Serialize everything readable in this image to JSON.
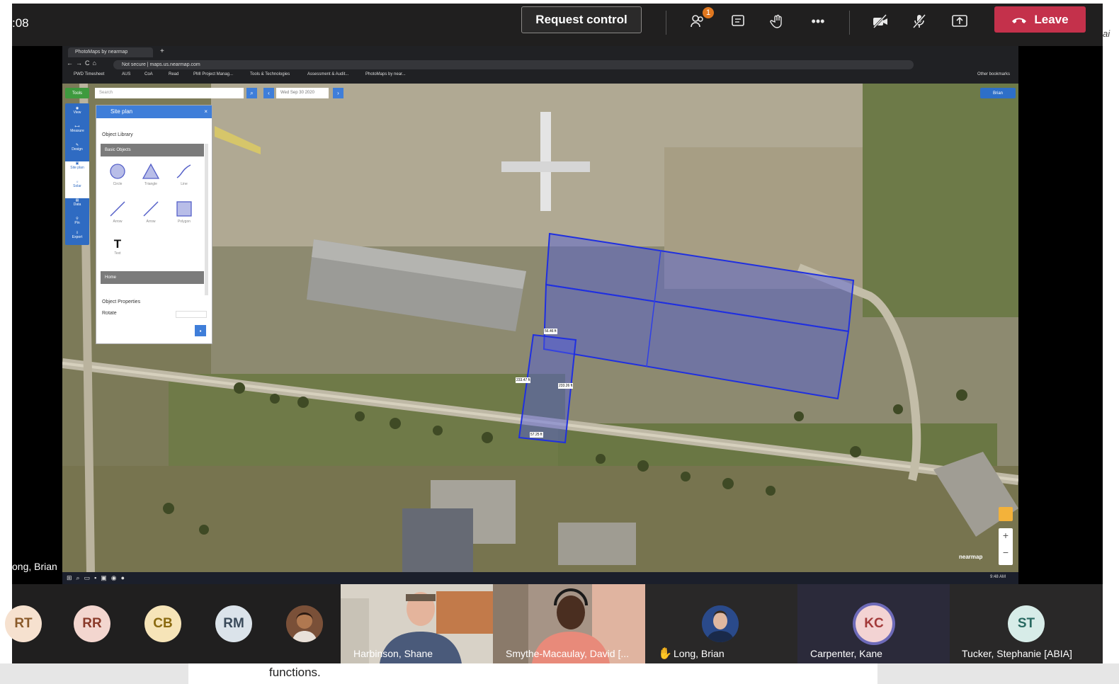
{
  "clock": ":08",
  "toolbar": {
    "request_control": "Request control",
    "badge_count": "1",
    "leave_label": "Leave",
    "icons": [
      "people-icon",
      "chat-icon",
      "raise-hand-icon",
      "more-icon",
      "camera-off-icon",
      "mic-off-icon",
      "share-tray-icon"
    ]
  },
  "right_edge_text": "ai",
  "browser": {
    "tab_title": "PhotoMaps by nearmap",
    "address": "Not secure | maps.us.nearmap.com",
    "bookmarks": [
      "PWD Timesheet",
      "AUS",
      "CoA",
      "Read",
      "PMI Project Manag...",
      "Tools & Technologies",
      "Assessment & Audit...",
      "PhotoMaps by near..."
    ],
    "other_bookmarks": "Other bookmarks"
  },
  "map_ui": {
    "tools_label": "Tools",
    "search_placeholder": "Search",
    "date_label": "Wed Sep 30 2020",
    "user_label": "Brian",
    "side_nav": [
      "View",
      "Measure",
      "Design",
      "Site plan",
      "Solar",
      "Data",
      "Pin",
      "Export"
    ],
    "brand": "nearmap",
    "measurements": [
      "56.46 ft",
      "233.47 ft",
      "233.26 ft",
      "57.25 ft"
    ],
    "panel": {
      "title": "Site plan",
      "library_label": "Object Library",
      "basic_header": "Basic Objects",
      "objects": [
        "Circle",
        "Triangle",
        "Line",
        "Arrow",
        "Arrow",
        "Polygon",
        "Text"
      ],
      "home_header": "Home",
      "props_label": "Object Properties",
      "rotate_label": "Rotate"
    }
  },
  "presenter_label": "ong, Brian",
  "taskbar_time": "9:48 AM",
  "participants": [
    {
      "initials": "RT",
      "bg": "#f6e1cf",
      "fg": "#8a5a2a"
    },
    {
      "initials": "RR",
      "bg": "#f3d6cf",
      "fg": "#8a3a2a"
    },
    {
      "initials": "CB",
      "bg": "#f6e4b8",
      "fg": "#8a6a10"
    },
    {
      "initials": "RM",
      "bg": "#dbe3ea",
      "fg": "#3a4a5a"
    }
  ],
  "video_tiles": [
    {
      "name": "Harbinson, Shane"
    },
    {
      "name": "Smythe-Macaulay, David [..."
    }
  ],
  "named_participants": [
    {
      "name": "Long, Brian"
    },
    {
      "name": "Carpenter, Kane",
      "initials": "KC"
    },
    {
      "name": "Tucker, Stephanie [ABIA]",
      "initials": "ST"
    }
  ],
  "doc_text": "functions."
}
